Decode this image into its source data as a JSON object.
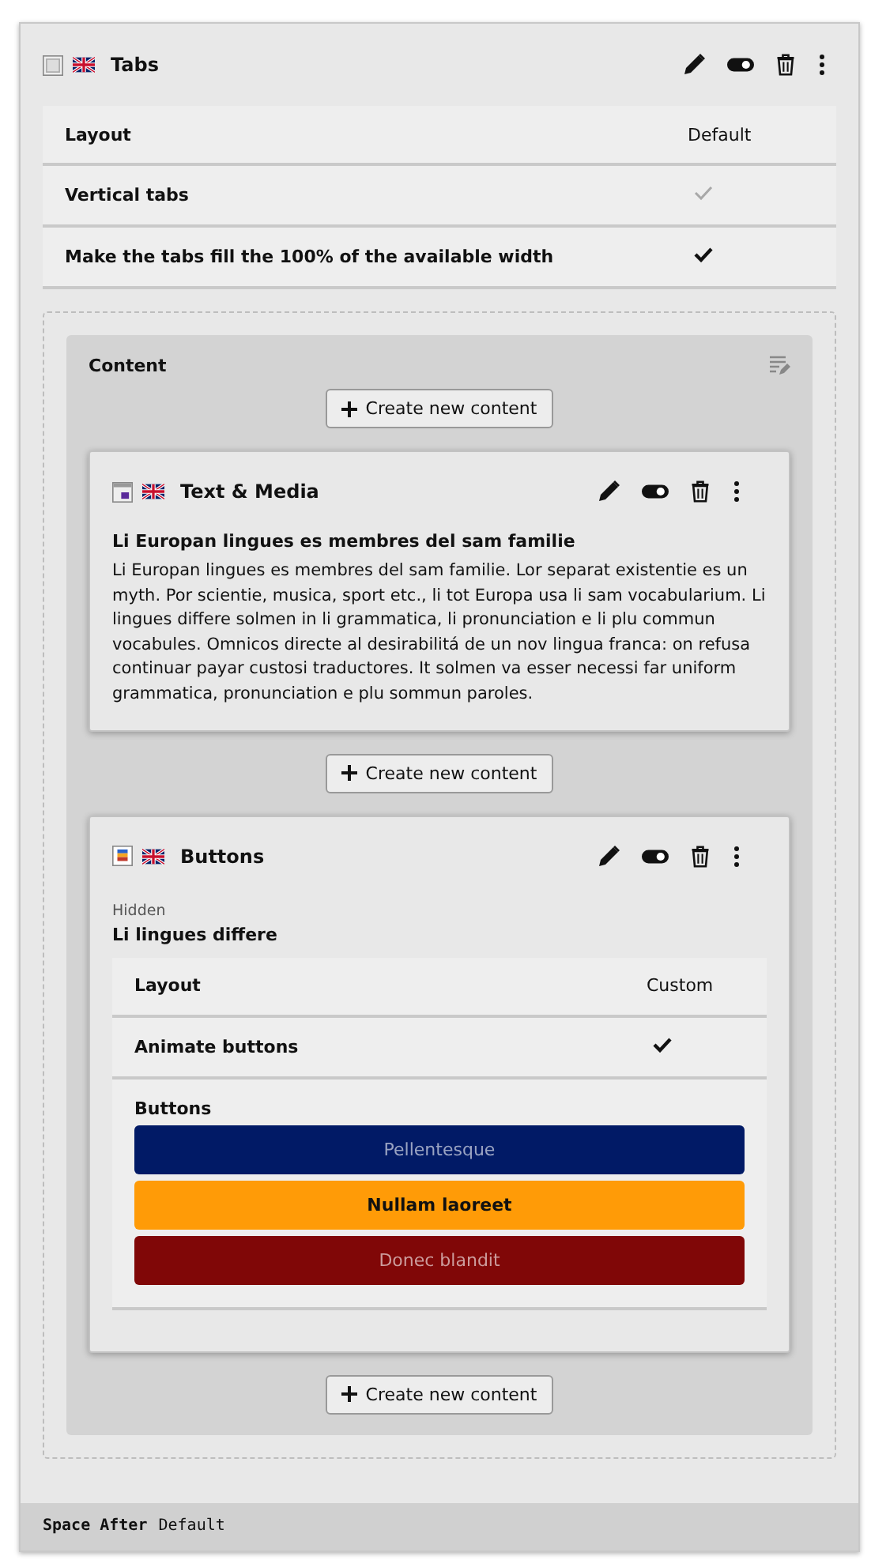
{
  "element": {
    "kind": "tabs",
    "title": "Tabs",
    "settings": [
      {
        "kind": "header",
        "label": "Layout",
        "value": "Default"
      },
      {
        "kind": "check",
        "label": "Vertical tabs",
        "checked": true,
        "inherited": true
      },
      {
        "kind": "check",
        "label": "Make the tabs fill the 100% of the available width",
        "checked": true,
        "inherited": false
      }
    ],
    "content": {
      "title": "Content",
      "add_labels": [
        "Create new content",
        "Create new content",
        "Create new content"
      ],
      "items": [
        {
          "kind": "textmedia",
          "title": "Text & Media",
          "heading": "Li Europan lingues es membres del sam familie",
          "body": "Li Europan lingues es membres del sam familie. Lor separat existentie es un myth. Por scientie, musica, sport etc., li tot Europa usa li sam vocabularium. Li lingues differe solmen in li grammatica, li pronunciation e li plu commun vocabules. Omnicos directe al desirabilitá de un nov lingua franca: on refusa continuar payar custosi traductores. It solmen va esser necessi far uniform grammatica, pronunciation e plu sommun paroles."
        },
        {
          "kind": "buttons",
          "title": "Buttons",
          "status": "Hidden",
          "heading": "Li lingues differe",
          "settings": [
            {
              "kind": "header",
              "label": "Layout",
              "value": "Custom"
            },
            {
              "kind": "check",
              "label": "Animate buttons",
              "checked": true,
              "inherited": false
            }
          ],
          "group_label": "Buttons",
          "buttons": [
            {
              "label": "Pellentesque",
              "color": "#011a66"
            },
            {
              "label": "Nullam laoreet",
              "color": "#ff9b07"
            },
            {
              "label": "Donec blandit",
              "color": "#800707"
            }
          ]
        }
      ]
    }
  },
  "footer": {
    "label": "Space After",
    "value": "Default"
  }
}
